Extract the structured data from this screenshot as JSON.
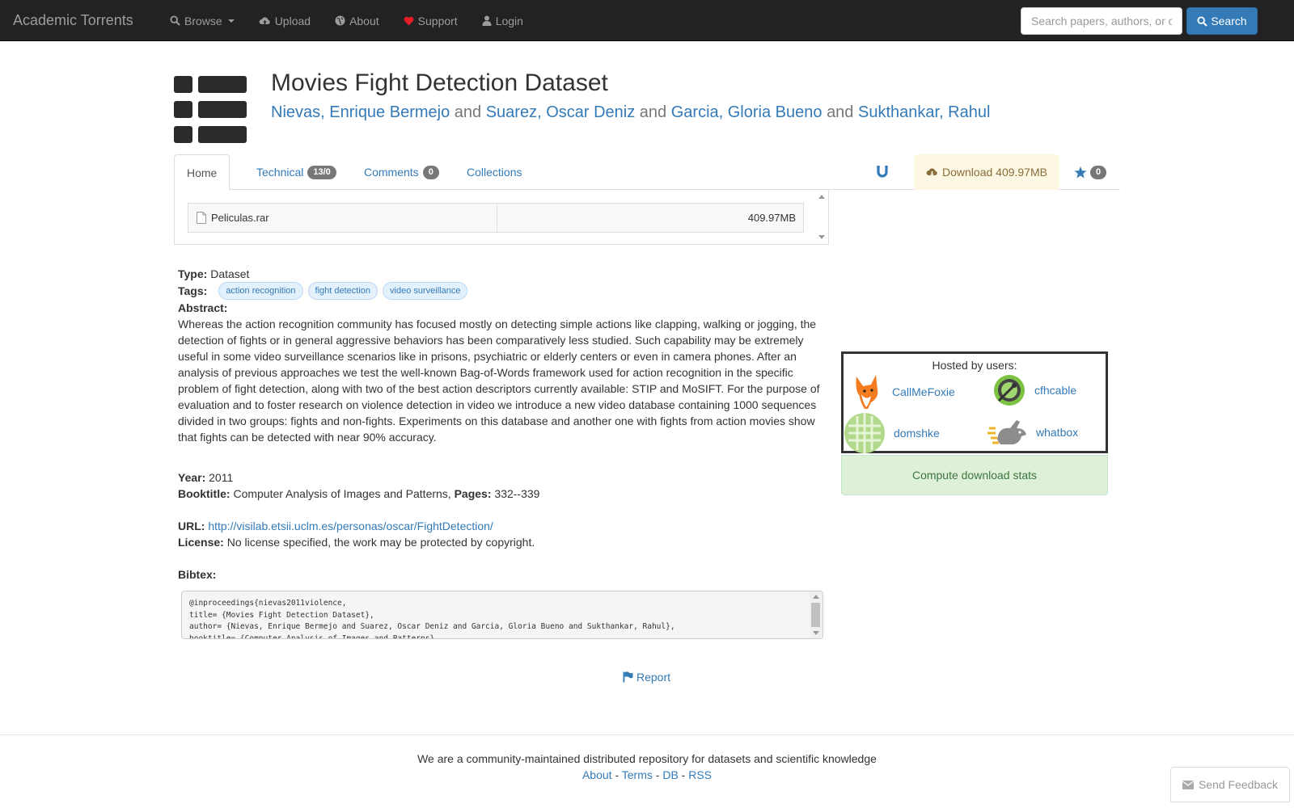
{
  "navbar": {
    "brand": "Academic Torrents",
    "items": [
      {
        "label": "Browse",
        "icon": "search-icon"
      },
      {
        "label": "Upload",
        "icon": "cloud-upload-icon"
      },
      {
        "label": "About",
        "icon": "globe-icon"
      },
      {
        "label": "Support",
        "icon": "heart-icon"
      },
      {
        "label": "Login",
        "icon": "user-icon"
      }
    ],
    "search_placeholder": "Search papers, authors, or c",
    "search_button": "Search"
  },
  "paper": {
    "title": "Movies Fight Detection Dataset",
    "authors": [
      "Nievas, Enrique Bermejo",
      "Suarez, Oscar Deniz",
      "Garcia, Gloria Bueno",
      "Sukthankar, Rahul"
    ],
    "author_separator": "and"
  },
  "tabs": {
    "home": "Home",
    "technical": "Technical",
    "technical_badge": "13/0",
    "comments": "Comments",
    "comments_badge": "0",
    "collections": "Collections",
    "download": "Download 409.97MB",
    "star_badge": "0"
  },
  "files": [
    {
      "name": "Peliculas.rar",
      "size": "409.97MB"
    }
  ],
  "details": {
    "type_label": "Type:",
    "type_value": "Dataset",
    "tags_label": "Tags:",
    "tags": [
      "action recognition",
      "fight detection",
      "video surveillance"
    ],
    "abstract_label": "Abstract:",
    "abstract": "Whereas the action recognition community has focused mostly on detecting simple actions like clapping, walking or jogging, the detection of fights or in general aggressive behaviors has been comparatively less studied. Such capability may be extremely useful in some video surveillance scenarios like in prisons, psychiatric or elderly centers or even in camera phones. After an analysis of previous approaches we test the well-known Bag-of-Words framework used for action recognition in the specific problem of fight detection, along with two of the best action descriptors currently available: STIP and MoSIFT. For the purpose of evaluation and to foster research on violence detection in video we introduce a new video database containing 1000 sequences divided in two groups: fights and non-fights. Experiments on this database and another one with fights from action movies show that fights can be detected with near 90% accuracy.",
    "year_label": "Year:",
    "year": "2011",
    "booktitle_label": "Booktitle:",
    "booktitle": "Computer Analysis of Images and Patterns,",
    "pages_label": "Pages:",
    "pages": "332--339",
    "url_label": "URL:",
    "url": "http://visilab.etsii.uclm.es/personas/oscar/FightDetection/",
    "license_label": "License:",
    "license": "No license specified, the work may be protected by copyright.",
    "bibtex_label": "Bibtex:",
    "bibtex": "@inproceedings{nievas2011violence,\ntitle= {Movies Fight Detection Dataset},\nauthor= {Nievas, Enrique Bermejo and Suarez, Oscar Deniz and Garcia, Gloria Bueno and Sukthankar, Rahul},\nbooktitle= {Computer Analysis of Images and Patterns},"
  },
  "sidebar": {
    "hosted_title": "Hosted by users:",
    "hosts": [
      "CallMeFoxie",
      "cfhcable",
      "domshke",
      "whatbox"
    ],
    "compute_button": "Compute download stats"
  },
  "report": "Report",
  "footer": {
    "tagline": "We are a community-maintained distributed repository for datasets and scientific knowledge",
    "links": [
      "About",
      "Terms",
      "DB",
      "RSS"
    ],
    "feedback": "Send Feedback"
  },
  "colors": {
    "navbar_bg": "#222222",
    "link": "#337ab7",
    "download_tab_bg": "#fcf8e3",
    "compute_bg": "#dff0d8"
  }
}
